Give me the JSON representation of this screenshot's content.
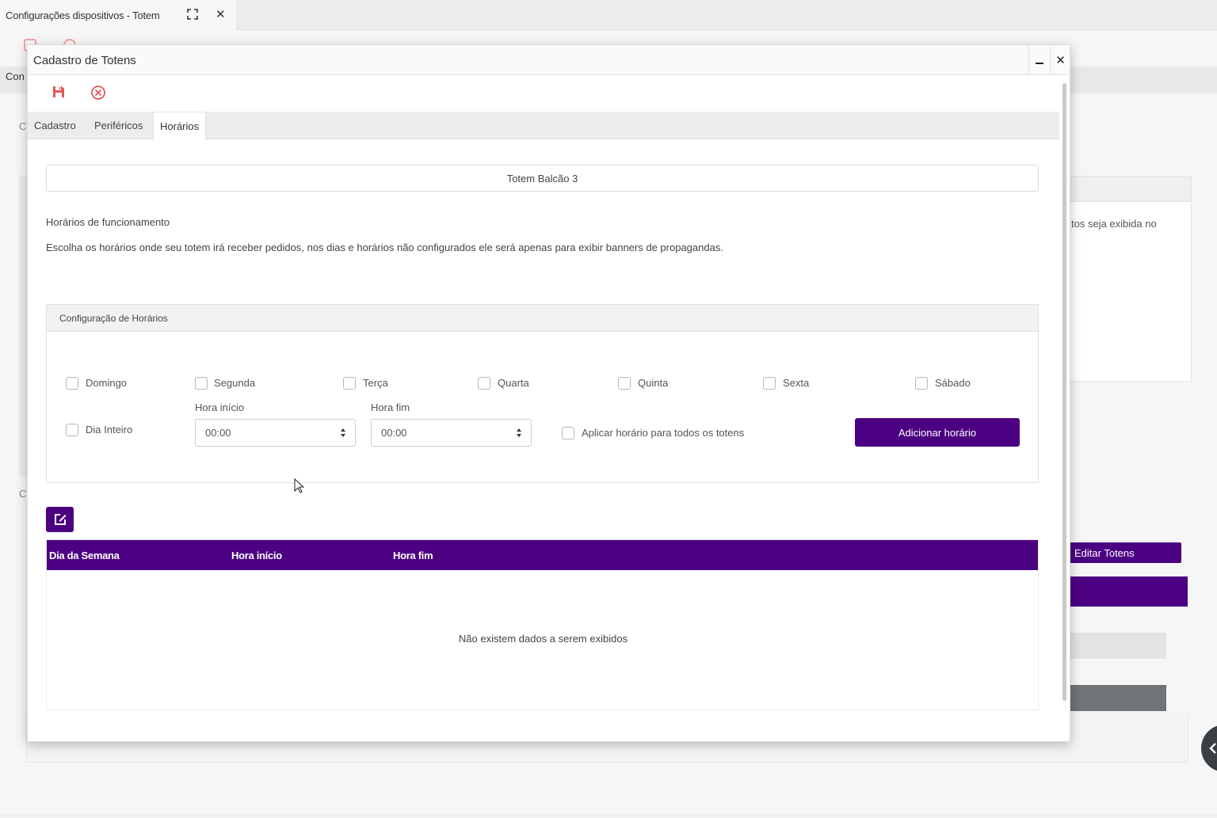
{
  "app_tab": {
    "title": "Configurações dispositivos - Totem",
    "close": "✕"
  },
  "background": {
    "label_con": "Con",
    "c1": "C",
    "c2": "C",
    "panel_text": "tos seja exibida no",
    "edit_totens": "Editar Totens"
  },
  "modal": {
    "title": "Cadastro de Totens",
    "close": "✕",
    "tabs": [
      {
        "label": "Cadastro"
      },
      {
        "label": "Periféricos"
      },
      {
        "label": "Horários"
      }
    ],
    "totem_name": "Totem Balcão 3",
    "section_title": "Horários de funcionamento",
    "section_desc": "Escolha os horários onde seu totem irá receber pedidos, nos dias e horários não configurados ele será apenas para exibir banners de propagandas.",
    "config": {
      "heading": "Configuração de Horários",
      "days": [
        {
          "label": "Domingo"
        },
        {
          "label": "Segunda"
        },
        {
          "label": "Terça"
        },
        {
          "label": "Quarta"
        },
        {
          "label": "Quinta"
        },
        {
          "label": "Sexta"
        },
        {
          "label": "Sábado"
        }
      ],
      "all_day_label": "Dia Inteiro",
      "start_label": "Hora início",
      "start_value": "00:00",
      "end_label": "Hora fim",
      "end_value": "00:00",
      "apply_all_label": "Aplicar horário para todos os totens",
      "add_button": "Adicionar horário"
    },
    "table": {
      "columns": [
        "Dia da Semana",
        "Hora início",
        "Hora fim"
      ],
      "empty_message": "Não existem dados a serem exibidos"
    }
  },
  "colors": {
    "accent": "#4b0082",
    "icon_red": "#e0585b"
  }
}
